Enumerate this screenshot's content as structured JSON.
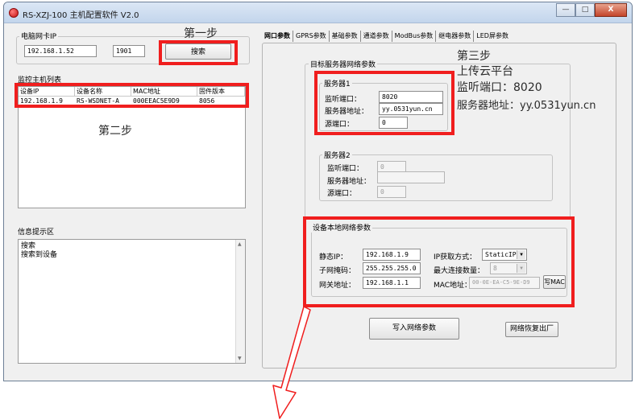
{
  "window": {
    "title": "RS-XZJ-100 主机配置软件 V2.0",
    "min_glyph": "—",
    "max_glyph": "□",
    "close_glyph": "X"
  },
  "left": {
    "pc_nic_group": "电脑网卡IP",
    "pc_ip": "192.168.1.52",
    "pc_port": "1901",
    "search_button": "搜索",
    "host_list_label": "监控主机列表",
    "columns": [
      "设备IP",
      "设备名称",
      "MAC地址",
      "固件版本"
    ],
    "rows": [
      [
        "192.168.1.9",
        "RS-WSDNET-A",
        "000EEAC5E9D9",
        "8056"
      ]
    ],
    "info_label": "信息提示区",
    "info_lines": [
      "搜索",
      "搜索到设备"
    ]
  },
  "annotations": {
    "step1": "第一步",
    "step2": "第二步",
    "step3_title": "第三步",
    "step3_line1": "上传云平台",
    "step3_line2": "监听端口：8020",
    "step3_line3": "服务器地址：yy.0531yun.cn"
  },
  "tabs": [
    "网口参数",
    "GPRS参数",
    "基础参数",
    "通道参数",
    "ModBus参数",
    "继电器参数",
    "LED屏参数"
  ],
  "server_group": {
    "title": "目标服务器网络参数",
    "server1": {
      "title": "服务器1",
      "listen_port_label": "监听端口：",
      "listen_port": "8020",
      "address_label": "服务器地址：",
      "address": "yy.0531yun.cn",
      "src_port_label": "源端口：",
      "src_port": "0"
    },
    "server2": {
      "title": "服务器2",
      "listen_port_label": "监听端口：",
      "listen_port": "0",
      "address_label": "服务器地址：",
      "address": "",
      "src_port_label": "源端口：",
      "src_port": "0"
    }
  },
  "local_group": {
    "title": "设备本地网络参数",
    "static_ip_label": "静态IP：",
    "static_ip": "192.168.1.9",
    "subnet_label": "子网掩码：",
    "subnet": "255.255.255.0",
    "gateway_label": "网关地址：",
    "gateway": "192.168.1.1",
    "ip_mode_label": "IP获取方式：",
    "ip_mode": "StaticIP",
    "max_conn_label": "最大连接数量：",
    "max_conn": "8",
    "mac_label": "MAC地址：",
    "mac": "00-0E-EA-C5-9E-D9",
    "write_mac_button": "写MAC"
  },
  "actions": {
    "write_button": "写入网络参数",
    "restore_button": "网络恢复出厂"
  },
  "colors": {
    "highlight": "#f01e1e"
  }
}
